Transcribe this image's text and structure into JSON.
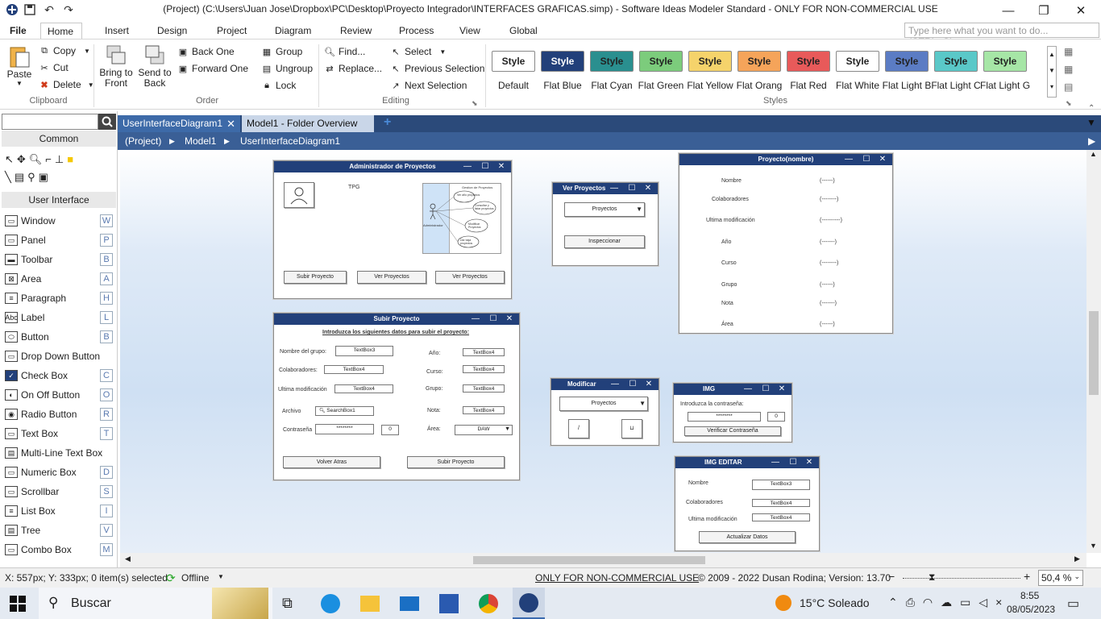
{
  "window": {
    "title": "(Project) (C:\\Users\\Juan Jose\\Dropbox\\PC\\Desktop\\Proyecto Integrador\\INTERFACES GRAFICAS.simp) - Software Ideas Modeler Standard - ONLY FOR NON-COMMERCIAL USE"
  },
  "menu_tabs": [
    "File",
    "Home",
    "Insert",
    "Design",
    "Project",
    "Diagram",
    "Review",
    "Process",
    "View",
    "Global"
  ],
  "help_search": {
    "placeholder": "Type here what you want to do... (CTRL+Q)"
  },
  "ribbon": {
    "clipboard": {
      "paste": "Paste",
      "copy": "Copy",
      "cut": "Cut",
      "delete": "Delete",
      "label": "Clipboard"
    },
    "order": {
      "bring_front": "Bring to Front",
      "send_back": "Send to Back",
      "back_one": "Back One",
      "forward_one": "Forward One",
      "label": "Order"
    },
    "group": {
      "group": "Group",
      "ungroup": "Ungroup",
      "lock": "Lock"
    },
    "editing": {
      "find": "Find...",
      "replace": "Replace...",
      "select": "Select",
      "prev_sel": "Previous Selection",
      "next_sel": "Next Selection",
      "label": "Editing"
    },
    "styles": {
      "label": "Styles",
      "button_text": "Style",
      "items": [
        {
          "name": "Default",
          "bg": "#ffffff",
          "fg": "#222222"
        },
        {
          "name": "Flat Blue",
          "bg": "#22407a",
          "fg": "#ffffff"
        },
        {
          "name": "Flat Cyan",
          "bg": "#2a8f8f",
          "fg": "#222222"
        },
        {
          "name": "Flat Green",
          "bg": "#7ccc7c",
          "fg": "#222222"
        },
        {
          "name": "Flat Yellow",
          "bg": "#f5d36b",
          "fg": "#222222"
        },
        {
          "name": "Flat Orang",
          "bg": "#f5a45a",
          "fg": "#222222"
        },
        {
          "name": "Flat Red",
          "bg": "#e85a5a",
          "fg": "#222222"
        },
        {
          "name": "Flat White",
          "bg": "#ffffff",
          "fg": "#222222"
        },
        {
          "name": "Flat Light B",
          "bg": "#5b7cc4",
          "fg": "#222222"
        },
        {
          "name": "Flat Light C",
          "bg": "#5ac8c8",
          "fg": "#222222"
        },
        {
          "name": "Flat Light G",
          "bg": "#a6e6a6",
          "fg": "#222222"
        }
      ]
    }
  },
  "toolbox": {
    "sections": {
      "common": "Common",
      "ui": "User Interface"
    },
    "items": [
      {
        "label": "Window",
        "key": "W"
      },
      {
        "label": "Panel",
        "key": "P"
      },
      {
        "label": "Toolbar",
        "key": "B"
      },
      {
        "label": "Area",
        "key": "A"
      },
      {
        "label": "Paragraph",
        "key": "H"
      },
      {
        "label": "Label",
        "key": "L"
      },
      {
        "label": "Button",
        "key": "B"
      },
      {
        "label": "Drop Down Button",
        "key": ""
      },
      {
        "label": "Check Box",
        "key": "C"
      },
      {
        "label": "On Off Button",
        "key": "O"
      },
      {
        "label": "Radio Button",
        "key": "R"
      },
      {
        "label": "Text Box",
        "key": "T"
      },
      {
        "label": "Multi-Line Text Box",
        "key": ""
      },
      {
        "label": "Numeric Box",
        "key": "D"
      },
      {
        "label": "Scrollbar",
        "key": "S"
      },
      {
        "label": "List Box",
        "key": "I"
      },
      {
        "label": "Tree",
        "key": "V"
      },
      {
        "label": "Combo Box",
        "key": "M"
      }
    ]
  },
  "doc_tabs": [
    "UserInterfaceDiagram1",
    "Model1 - Folder Overview"
  ],
  "breadcrumb": [
    "(Project)",
    "Model1",
    "UserInterfaceDiagram1"
  ],
  "diagram": {
    "admin": {
      "title": "Administrador de Proyectos",
      "tpg": "TPG",
      "b1": "Subir Proyecto",
      "b2": "Ver Proyectos",
      "b3": "Ver Proyectos"
    },
    "ver": {
      "title": "Ver Proyectos",
      "combo": "Proyectos",
      "btn": "Inspeccionar"
    },
    "proyecto": {
      "title": "Proyecto(nombre)",
      "rows": [
        {
          "k": "Nombre",
          "v": "(------)"
        },
        {
          "k": "Colaboradores",
          "v": "(--------)"
        },
        {
          "k": "Ultima modificación",
          "v": "(----------)"
        },
        {
          "k": "Año",
          "v": "(-------)"
        },
        {
          "k": "Curso",
          "v": "(--------)"
        },
        {
          "k": "Grupo",
          "v": "(------)"
        },
        {
          "k": "Nota",
          "v": "(-------)"
        },
        {
          "k": "Área",
          "v": "(------)"
        }
      ]
    },
    "subir": {
      "title": "Subir Proyecto",
      "intro": "Introduzca los siguientes datos para subir el proyecto:",
      "nombre_grupo": "Nombre del grupo:",
      "tb3": "TextBox3",
      "colab": "Colaboradores:",
      "tb4": "TextBox4",
      "ultima": "Ultima modificación",
      "archivo": "Archivo",
      "search": "SearchBox1",
      "contra": "Contraseña",
      "pwd": "********",
      "zero": "0",
      "anio": "Año:",
      "curso": "Curso:",
      "grupo": "Grupo:",
      "nota": "Nota:",
      "area": "Área:",
      "daw": "DAW",
      "volver": "Volver Atras",
      "subir_btn": "Subir Proyecto"
    },
    "modificar": {
      "title": "Modificar",
      "combo": "Proyectos",
      "b1": "/",
      "b2": "⊔"
    },
    "img": {
      "title": "IMG",
      "lbl": "Introduzca la contraseña:",
      "pwd": "********",
      "zero": "0",
      "btn": "Verificar Contraseña"
    },
    "img_editar": {
      "title": "IMG EDITAR",
      "nombre": "Nombre",
      "tb3": "TextBox3",
      "colab": "Colaboradores",
      "tb4": "TextBox4",
      "ultima": "Ultima modificación",
      "btn": "Actualizar Datos"
    },
    "usecase": {
      "title": "Gestion de Proyectos",
      "actor": "Administrador",
      "uc": [
        "Ver año proyectos",
        "Consultar y listar proyectos",
        "Modificar Proyectos",
        "Dar baja proyectos"
      ]
    }
  },
  "status": {
    "coords": "X: 557px; Y: 333px; 0 item(s) selected",
    "offline": "Offline",
    "license": "ONLY FOR NON-COMMERCIAL USE",
    "copyright": "© 2009 - 2022 Dusan Rodina; Version: 13.70",
    "zoom": "50,4 %"
  },
  "taskbar": {
    "search": "Buscar",
    "weather": "15°C  Soleado",
    "time": "8:55",
    "date": "08/05/2023"
  }
}
